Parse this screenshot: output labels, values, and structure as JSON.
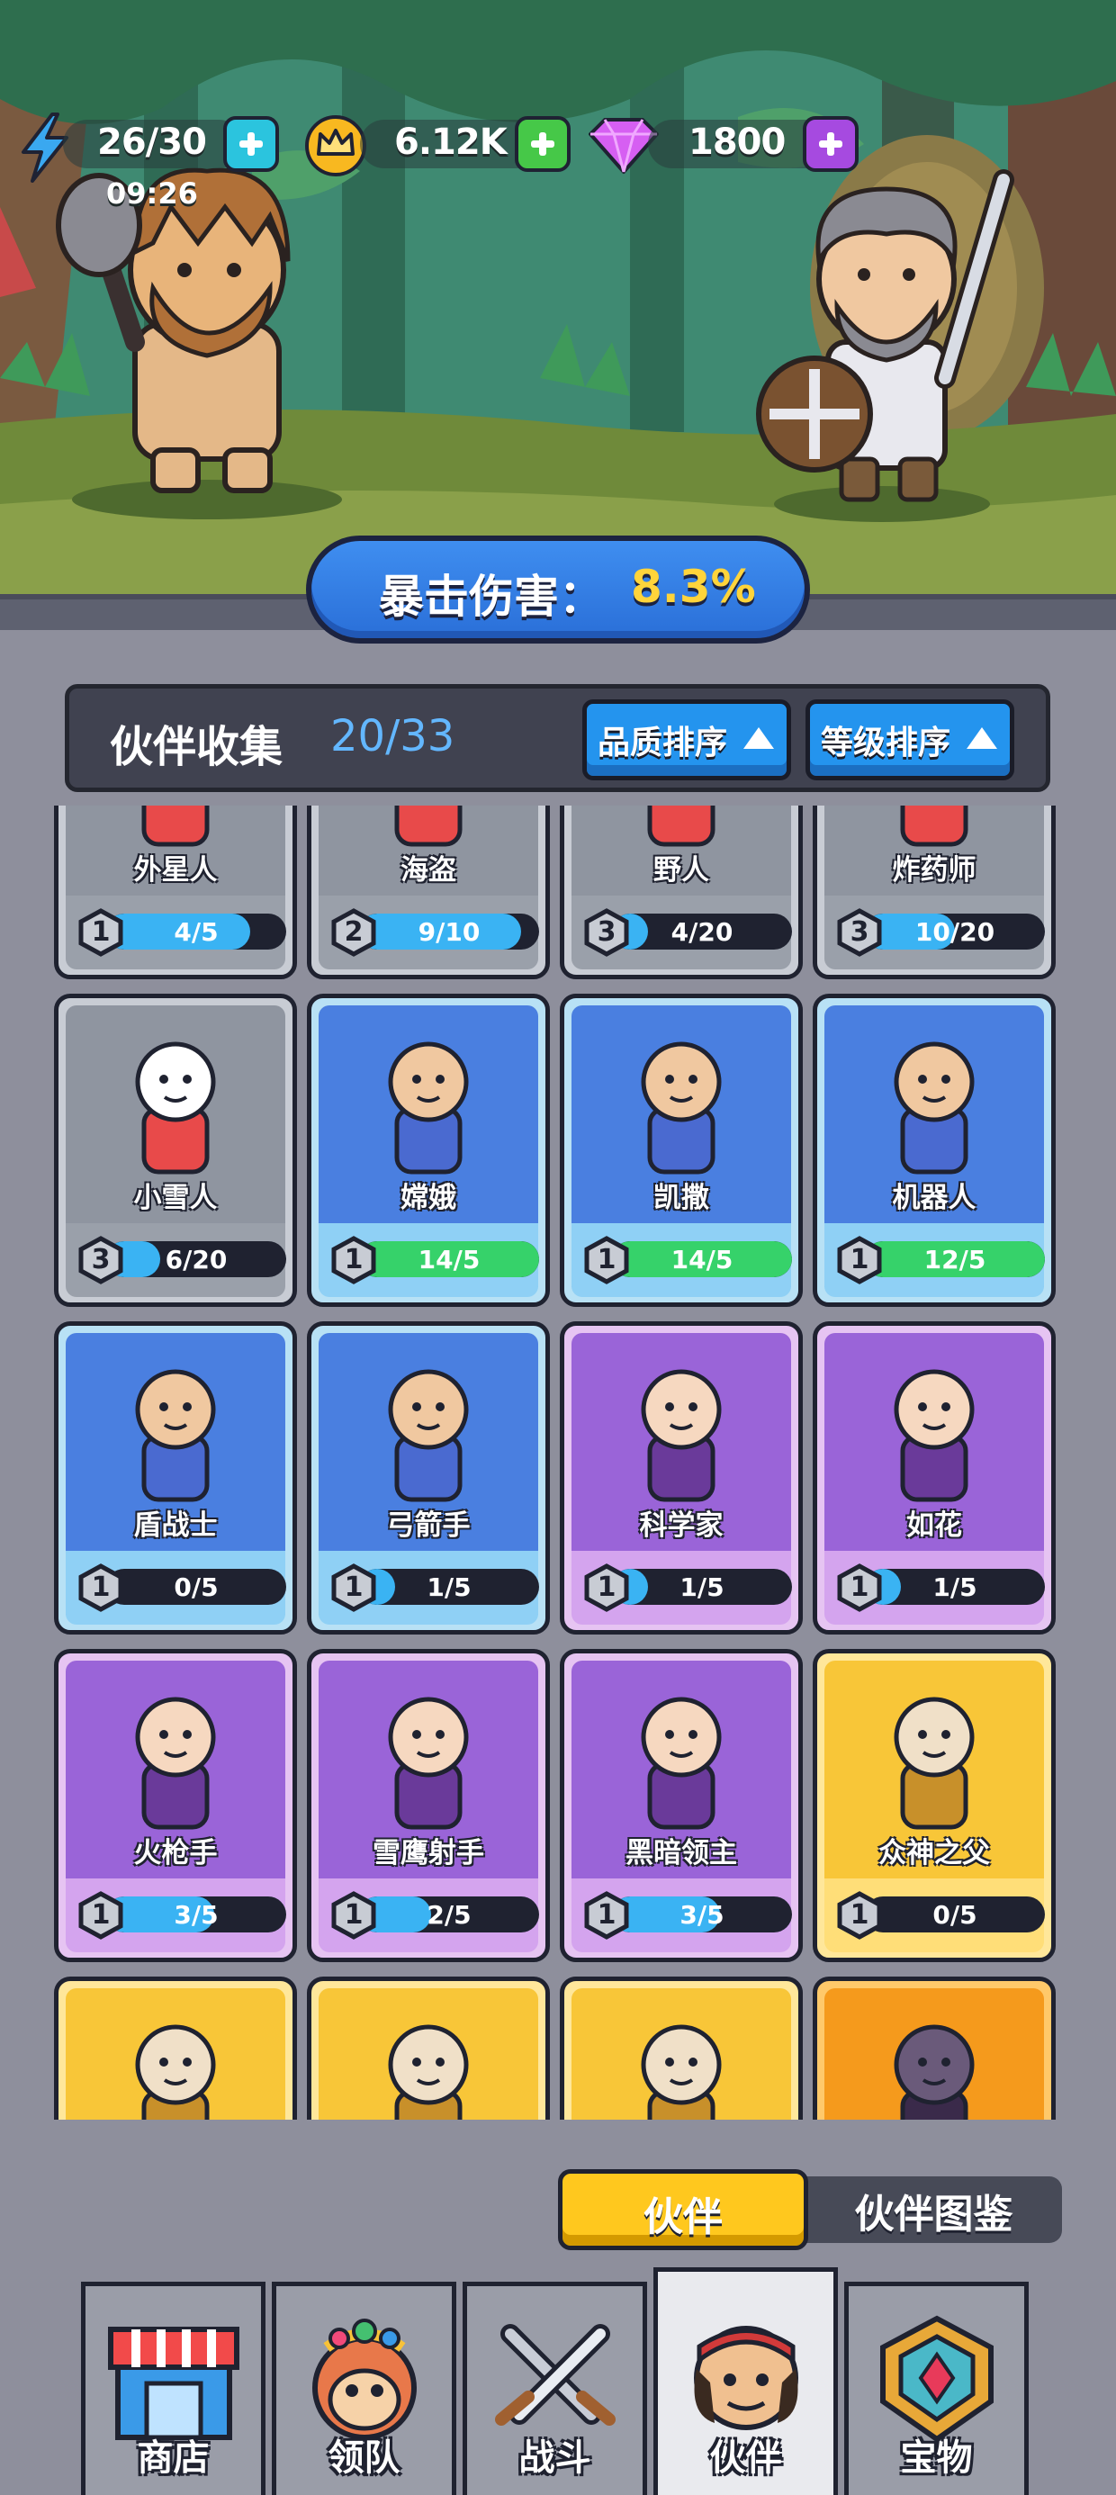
{
  "hud": {
    "energy": "26/30",
    "energy_timer": "09:26",
    "coins": "6.12K",
    "gems": "1800",
    "icons": [
      "lightning-icon",
      "crown-coin-icon",
      "diamond-gem-icon",
      "plus-icon"
    ]
  },
  "banner": {
    "label": "暴击伤害：",
    "value": "8.3%"
  },
  "collection": {
    "title": "伙伴收集",
    "count": "20/33",
    "sort_quality": "品质排序",
    "sort_level": "等级排序"
  },
  "cards": [
    {
      "name": "外星人",
      "level": "1",
      "progress": "4/5",
      "fill": 0.8,
      "tier": "gray",
      "bar": "blue"
    },
    {
      "name": "海盗",
      "level": "2",
      "progress": "9/10",
      "fill": 0.9,
      "tier": "gray",
      "bar": "blue"
    },
    {
      "name": "野人",
      "level": "3",
      "progress": "4/20",
      "fill": 0.2,
      "tier": "gray",
      "bar": "blue"
    },
    {
      "name": "炸药师",
      "level": "3",
      "progress": "10/20",
      "fill": 0.5,
      "tier": "gray",
      "bar": "blue"
    },
    {
      "name": "小雪人",
      "level": "3",
      "progress": "6/20",
      "fill": 0.3,
      "tier": "gray",
      "bar": "blue"
    },
    {
      "name": "嫦娥",
      "level": "1",
      "progress": "14/5",
      "fill": 1.0,
      "tier": "blue",
      "bar": "green"
    },
    {
      "name": "凯撒",
      "level": "1",
      "progress": "14/5",
      "fill": 1.0,
      "tier": "blue",
      "bar": "green"
    },
    {
      "name": "机器人",
      "level": "1",
      "progress": "12/5",
      "fill": 1.0,
      "tier": "blue",
      "bar": "green"
    },
    {
      "name": "盾战士",
      "level": "1",
      "progress": "0/5",
      "fill": 0.0,
      "tier": "blue",
      "bar": "blue"
    },
    {
      "name": "弓箭手",
      "level": "1",
      "progress": "1/5",
      "fill": 0.2,
      "tier": "blue",
      "bar": "blue"
    },
    {
      "name": "科学家",
      "level": "1",
      "progress": "1/5",
      "fill": 0.2,
      "tier": "purple",
      "bar": "blue"
    },
    {
      "name": "如花",
      "level": "1",
      "progress": "1/5",
      "fill": 0.2,
      "tier": "purple",
      "bar": "blue"
    },
    {
      "name": "火枪手",
      "level": "1",
      "progress": "3/5",
      "fill": 0.6,
      "tier": "purple",
      "bar": "blue"
    },
    {
      "name": "雪鹰射手",
      "level": "1",
      "progress": "2/5",
      "fill": 0.4,
      "tier": "purple",
      "bar": "blue"
    },
    {
      "name": "黑暗领主",
      "level": "1",
      "progress": "3/5",
      "fill": 0.6,
      "tier": "purple",
      "bar": "blue"
    },
    {
      "name": "众神之父",
      "level": "1",
      "progress": "0/5",
      "fill": 0.0,
      "tier": "gold",
      "bar": "blue"
    },
    {
      "name": "",
      "level": "",
      "progress": "",
      "fill": 0,
      "tier": "gold",
      "bar": "blue"
    },
    {
      "name": "",
      "level": "",
      "progress": "",
      "fill": 0,
      "tier": "gold",
      "bar": "blue"
    },
    {
      "name": "",
      "level": "",
      "progress": "",
      "fill": 0,
      "tier": "gold",
      "bar": "blue"
    },
    {
      "name": "",
      "level": "",
      "progress": "",
      "fill": 0,
      "tier": "orange",
      "bar": "blue"
    }
  ],
  "toggle": {
    "active": "伙伴",
    "inactive": "伙伴图鉴"
  },
  "nav": [
    {
      "label": "商店",
      "icon": "shop-icon"
    },
    {
      "label": "领队",
      "icon": "monkey-leader-icon"
    },
    {
      "label": "战斗",
      "icon": "crossed-swords-icon"
    },
    {
      "label": "伙伴",
      "icon": "pirate-partner-icon",
      "active": true
    },
    {
      "label": "宝物",
      "icon": "treasure-emblem-icon"
    }
  ],
  "colors": {
    "accent_blue": "#2494ee",
    "gold": "#ffc81e",
    "crit_value": "#ffd43b",
    "count_blue": "#63b7ff"
  }
}
